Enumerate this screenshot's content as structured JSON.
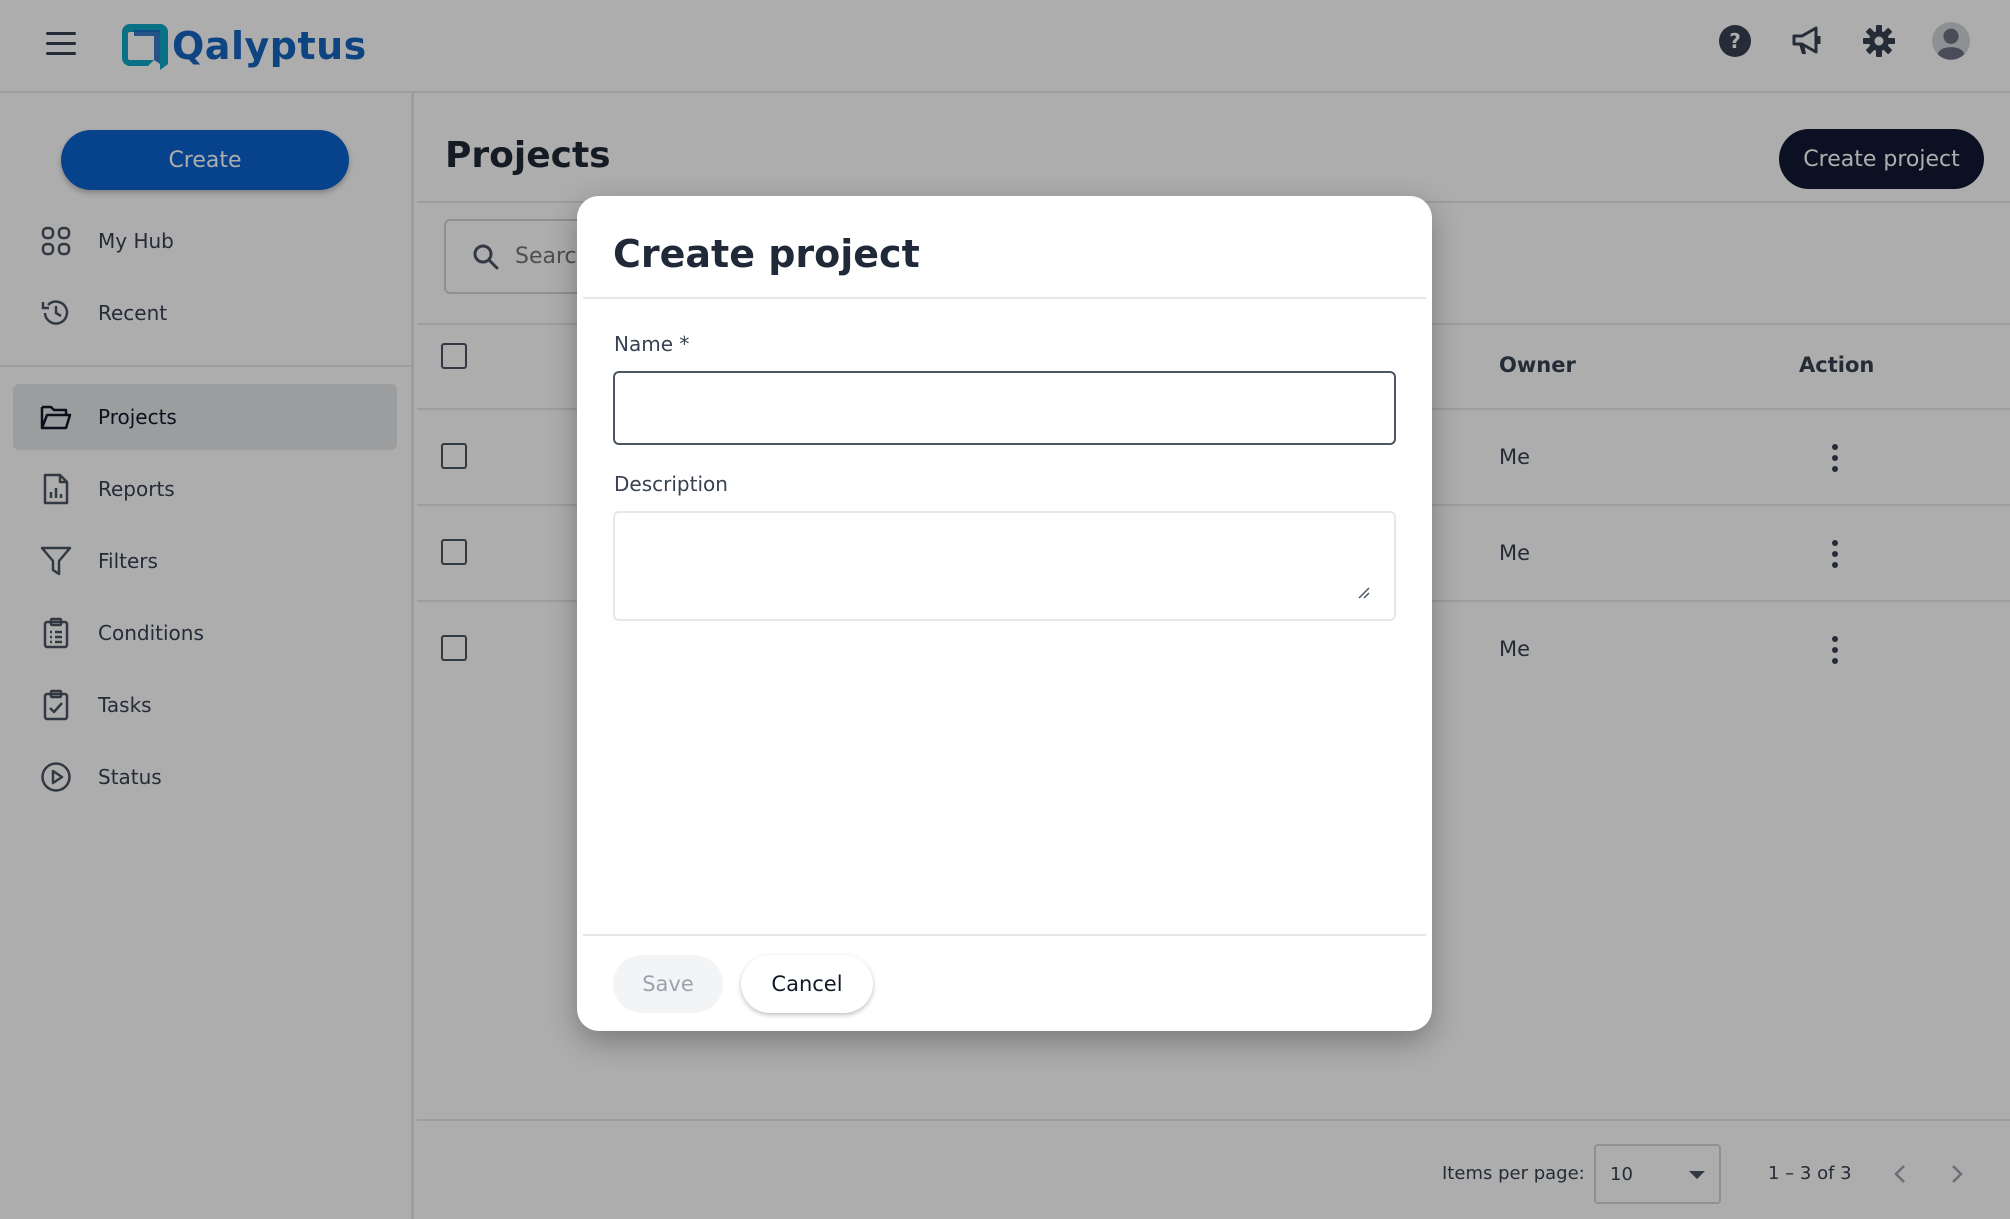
{
  "header": {
    "logo_text": "Qalyptus",
    "icons": [
      "help-icon",
      "megaphone-icon",
      "gear-icon",
      "avatar-icon"
    ]
  },
  "sidebar": {
    "create_label": "Create",
    "items": [
      {
        "label": "My Hub",
        "icon": "grid-icon"
      },
      {
        "label": "Recent",
        "icon": "history-icon"
      },
      {
        "label": "Projects",
        "icon": "folder-open-icon",
        "active": true
      },
      {
        "label": "Reports",
        "icon": "report-icon"
      },
      {
        "label": "Filters",
        "icon": "filter-icon"
      },
      {
        "label": "Conditions",
        "icon": "clipboard-list-icon"
      },
      {
        "label": "Tasks",
        "icon": "clipboard-check-icon"
      },
      {
        "label": "Status",
        "icon": "play-circle-icon"
      }
    ]
  },
  "main": {
    "title": "Projects",
    "create_project_label": "Create project",
    "search_placeholder": "Search",
    "columns": {
      "owner": "Owner",
      "action": "Action"
    },
    "rows": [
      {
        "owner": "Me"
      },
      {
        "owner": "Me"
      },
      {
        "owner": "Me"
      }
    ],
    "pagination": {
      "items_per_page_label": "Items per page:",
      "items_per_page_value": "10",
      "range_label": "1 – 3 of 3"
    }
  },
  "dialog": {
    "title": "Create project",
    "name_label": "Name *",
    "name_value": "",
    "description_label": "Description",
    "description_value": "",
    "save_label": "Save",
    "cancel_label": "Cancel"
  },
  "colors": {
    "brand": "#1565c0",
    "primary_button": "#0b63ce",
    "dark_button": "#111a33"
  }
}
